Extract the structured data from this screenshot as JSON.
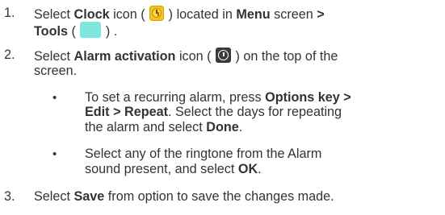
{
  "steps": [
    {
      "number": "1.",
      "lines": [
        {
          "pre": "Select ",
          "bold1": "Clock",
          "mid1": " icon ( ",
          "icon": "clock-icon",
          "post1": " ) located in ",
          "bold2": "Menu",
          "mid2": " screen ",
          "bold3": ">"
        },
        {
          "bold1": "Tools",
          "mid1": " ( ",
          "icon": "tools-icon",
          "post1": " ) ."
        }
      ]
    },
    {
      "number": "2.",
      "lines": [
        {
          "pre": "Select ",
          "bold1": "Alarm activation",
          "mid1": " icon ( ",
          "icon": "alarm-clock-icon",
          "post1": " ) on the top of the"
        },
        {
          "text": "screen."
        }
      ]
    },
    {
      "number": "3.",
      "lines": [
        {
          "pre": "Select ",
          "bold1": "Save",
          "post1": " from option to save the changes made."
        }
      ]
    }
  ],
  "bullets": [
    {
      "symbol": "•",
      "lines": [
        {
          "pre": "To set a recurring alarm, press ",
          "bold1": "Options key >"
        },
        {
          "bold1": "Edit > Repeat",
          "post1": ". Select the days for repeating"
        },
        {
          "pre": "the alarm and select ",
          "bold1": "Done",
          "post1": "."
        }
      ]
    },
    {
      "symbol": "•",
      "lines": [
        {
          "text": "Select any of the ringtone from the Alarm"
        },
        {
          "pre": "sound present, and select ",
          "bold1": "OK",
          "post1": "."
        }
      ]
    }
  ]
}
